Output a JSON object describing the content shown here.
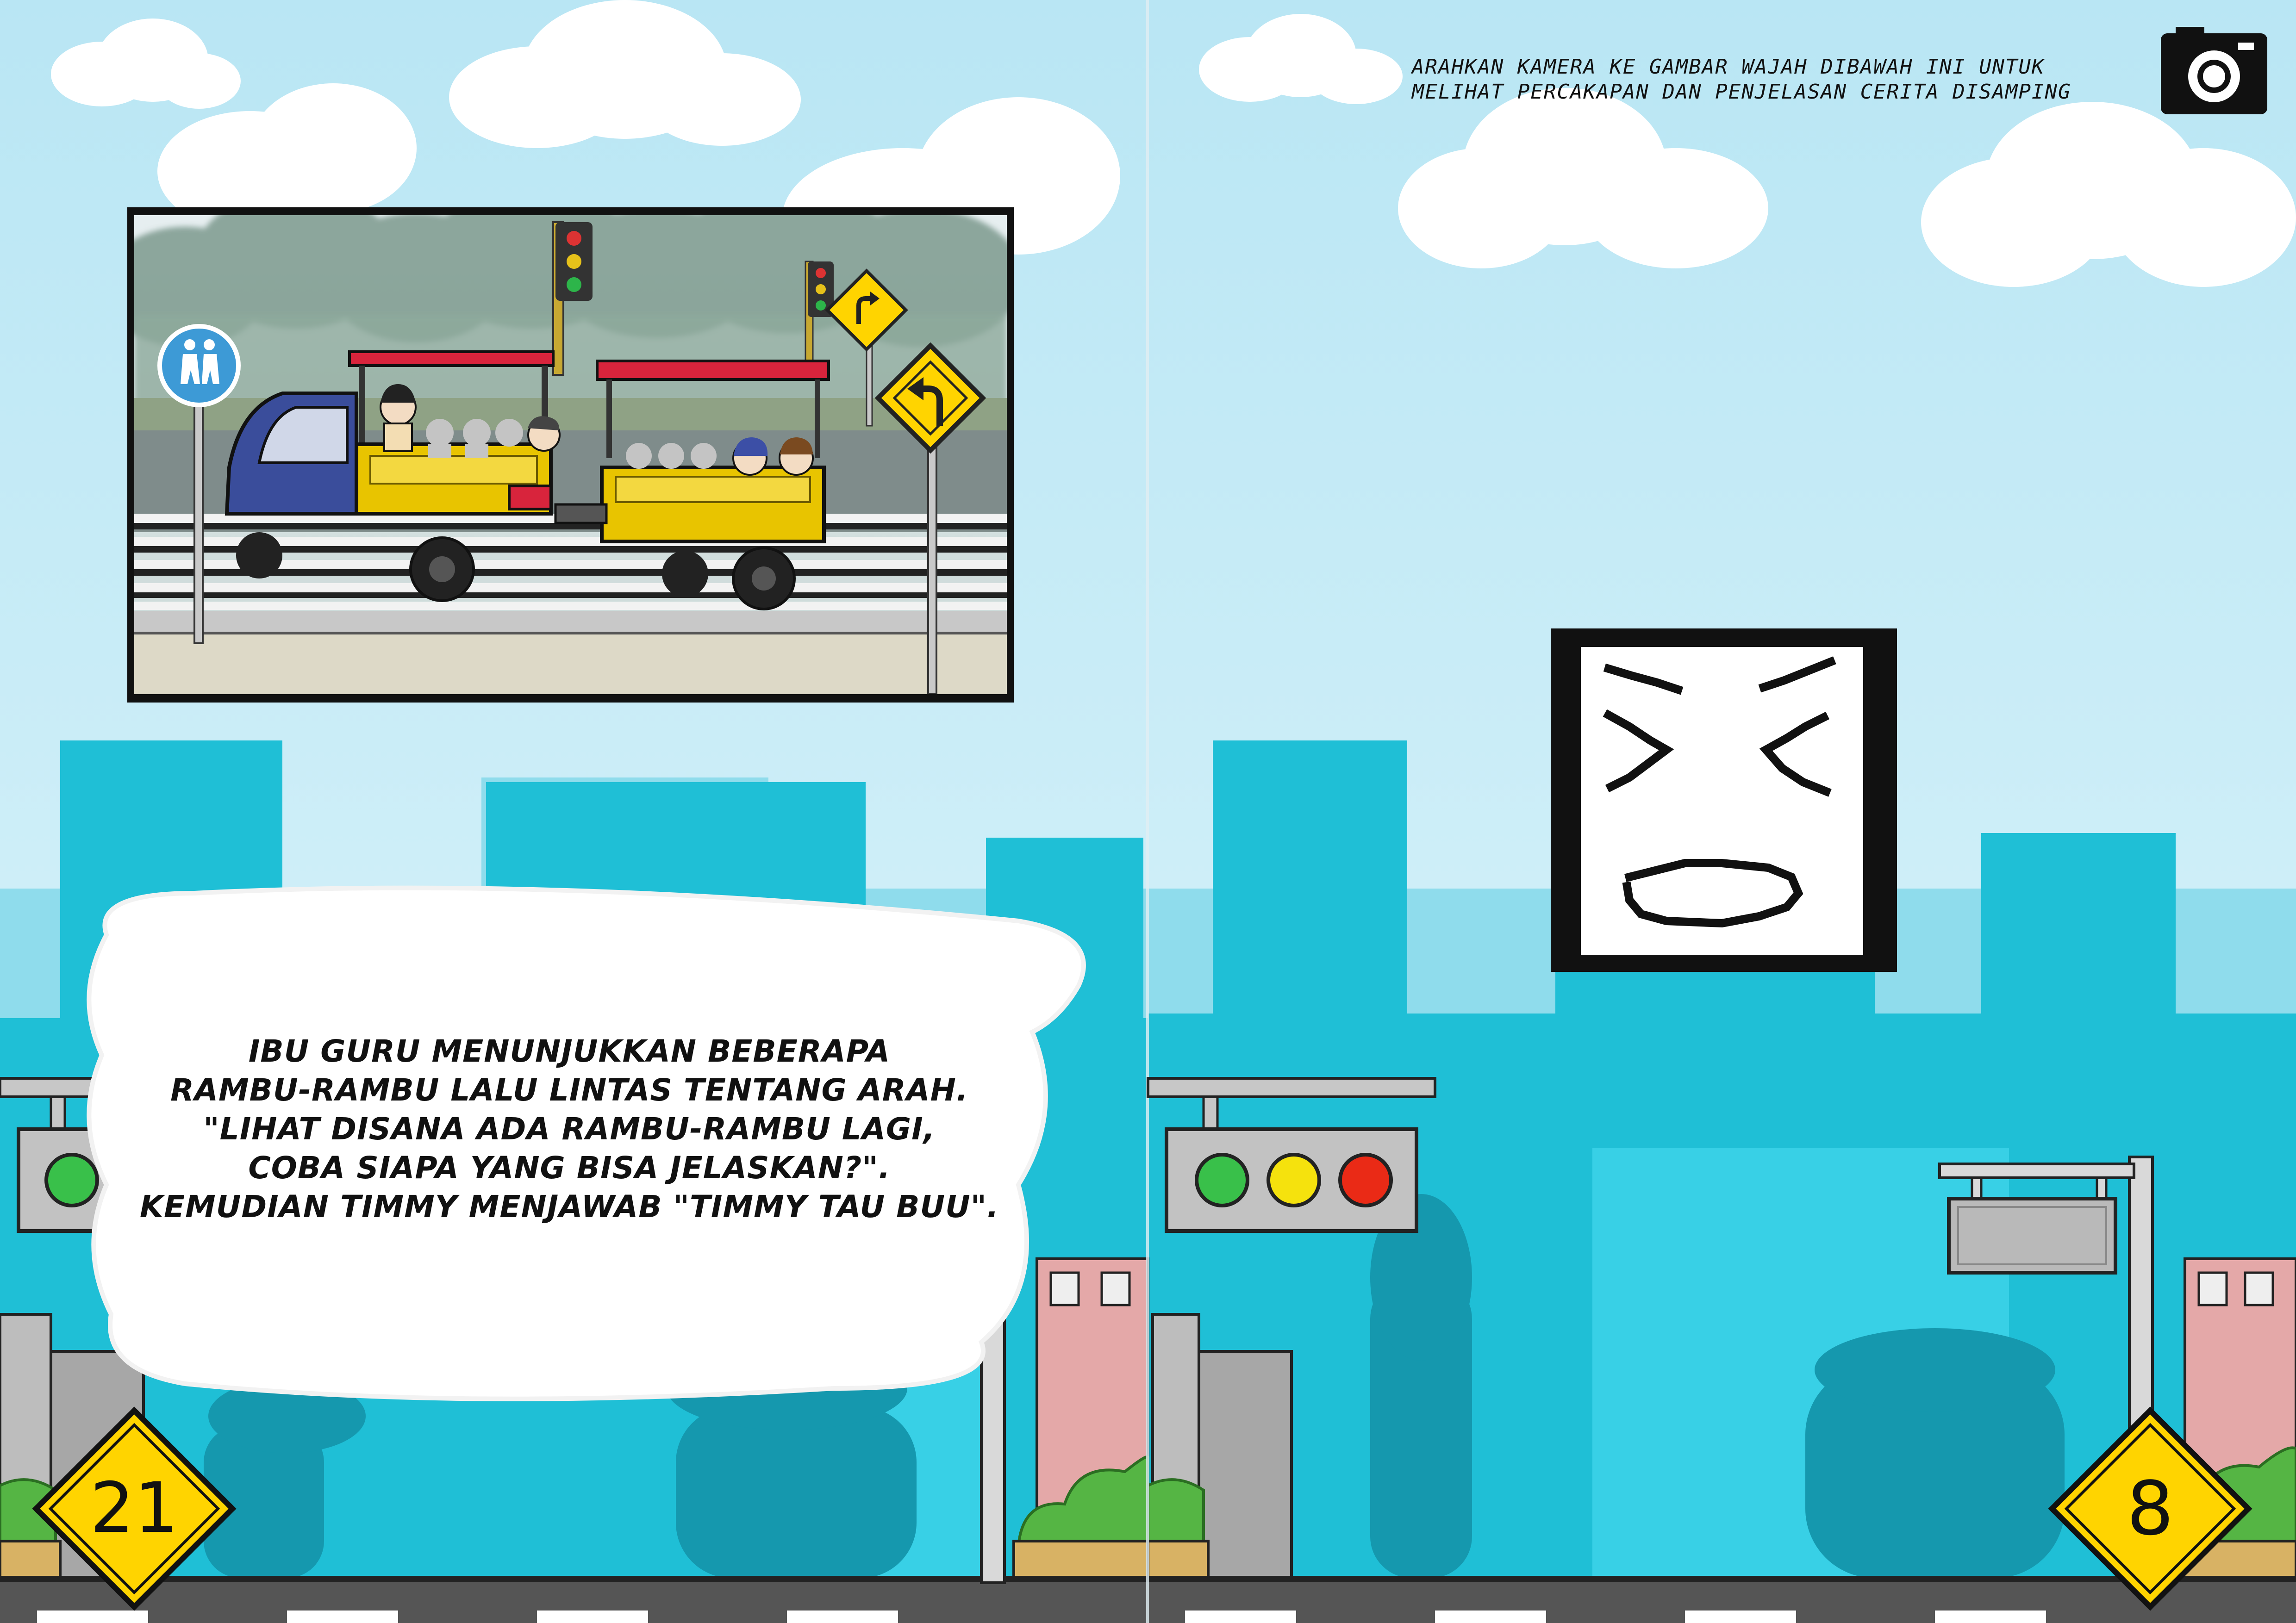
{
  "left_page": {
    "narration": [
      "IBU GURU MENUNJUKKAN BEBERAPA",
      "RAMBU-RAMBU LALU LINTAS TENTANG ARAH.",
      "\"LIHAT DISANA ADA RAMBU-RAMBU LAGI,",
      "COBA SIAPA YANG BISA JELASKAN?\".",
      "KEMUDIAN TIMMY MENJAWAB \"TIMMY TAU BUU\"."
    ],
    "page_number": "21"
  },
  "right_page": {
    "instruction": [
      "ARAHKAN KAMERA KE GAMBAR WAJAH DIBAWAH INI UNTUK",
      "MELIHAT PERCAKAPAN DAN PENJELASAN CERITA DISAMPING"
    ],
    "page_number": "8"
  },
  "icons": {
    "camera": "camera-icon",
    "face_marker": "laughing-face-marker",
    "traffic_light": "traffic-light-icon",
    "turn_sign": "turn-left-warning-sign",
    "pedestrian_sign": "pedestrian-sign-icon"
  },
  "colors": {
    "sky": "#c9ecf6",
    "city": "#22c0d6",
    "sign_yellow": "#ffd400",
    "bus_red": "#d8243c",
    "bus_yellow": "#e8c400"
  }
}
